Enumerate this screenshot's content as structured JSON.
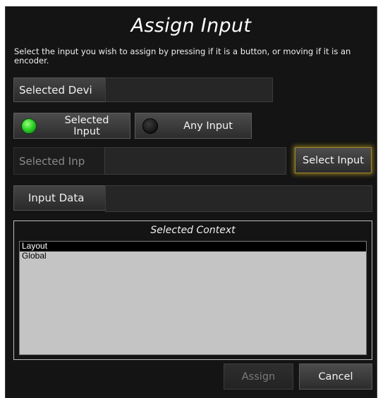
{
  "dialog": {
    "title": "Assign Input",
    "description": "Select the input you wish to assign by pressing if it is a button, or moving if it is an encoder."
  },
  "selected_device": {
    "label": "Selected Devi",
    "value": ""
  },
  "mode_toggles": {
    "selected_input_label": "Selected\nInput",
    "selected_input_led": "on",
    "any_input_label": "Any Input",
    "any_input_led": "off"
  },
  "selected_input": {
    "label": "Selected Inp",
    "value": "",
    "select_button": "Select Input"
  },
  "input_data": {
    "label": "Input Data",
    "value": ""
  },
  "context": {
    "title": "Selected Context",
    "items": [
      "Layout",
      "Global"
    ],
    "selected_index": 0
  },
  "footer": {
    "assign_label": "Assign",
    "cancel_label": "Cancel"
  },
  "colors": {
    "background": "#141414",
    "led_on": "#2fd42a",
    "glow": "#d2b428"
  }
}
